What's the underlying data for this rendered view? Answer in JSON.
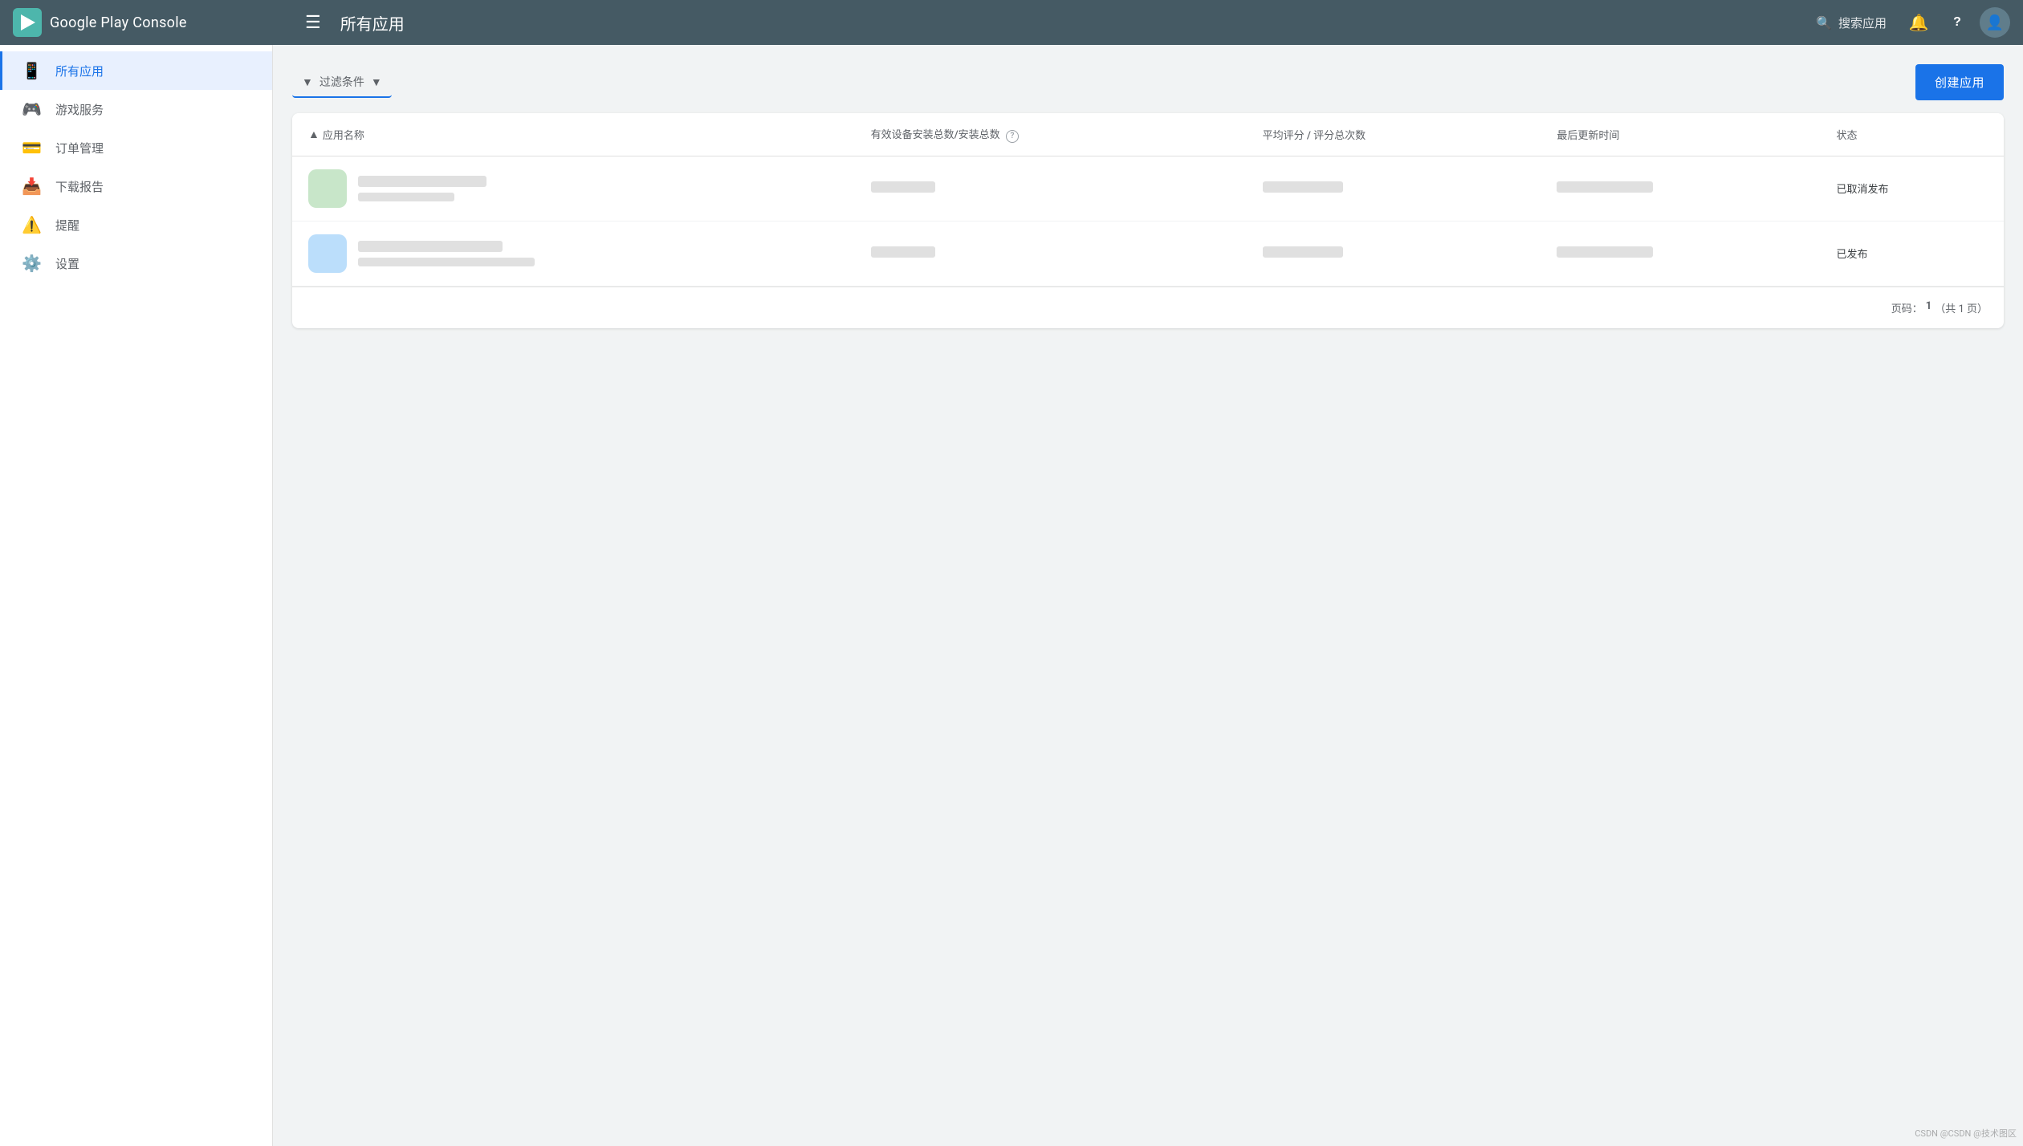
{
  "header": {
    "logo_text": "Google Play Console",
    "hamburger_label": "☰",
    "page_title": "所有应用",
    "search_placeholder": "搜索应用",
    "search_icon": "🔍",
    "notification_icon": "🔔",
    "help_icon": "?",
    "avatar_icon": "👤"
  },
  "sidebar": {
    "items": [
      {
        "id": "all-apps",
        "label": "所有应用",
        "icon": "📱",
        "active": true
      },
      {
        "id": "game-services",
        "label": "游戏服务",
        "icon": "🎮",
        "active": false
      },
      {
        "id": "order-mgmt",
        "label": "订单管理",
        "icon": "💳",
        "active": false
      },
      {
        "id": "reports",
        "label": "下载报告",
        "icon": "📥",
        "active": false
      },
      {
        "id": "alerts",
        "label": "提醒",
        "icon": "⚠️",
        "active": false
      },
      {
        "id": "settings",
        "label": "设置",
        "icon": "⚙️",
        "active": false
      }
    ]
  },
  "main": {
    "filter_label": "过滤条件",
    "filter_icon": "▼",
    "create_app_label": "创建应用",
    "table": {
      "columns": [
        {
          "id": "app-name",
          "label": "应用名称",
          "sortable": true,
          "sort_direction": "asc"
        },
        {
          "id": "installs",
          "label": "有效设备安装总数/安装总数",
          "has_info": true
        },
        {
          "id": "rating",
          "label": "平均评分 / 评分总次数"
        },
        {
          "id": "last-updated",
          "label": "最后更新时间"
        },
        {
          "id": "status",
          "label": "状态"
        }
      ],
      "rows": [
        {
          "id": "row-1",
          "app_name_redacted": true,
          "installs_redacted": true,
          "rating_redacted": true,
          "updated_redacted": true,
          "status": "已取消发布"
        },
        {
          "id": "row-2",
          "app_name_redacted": true,
          "installs_redacted": true,
          "rating_redacted": true,
          "updated_redacted": true,
          "status": "已发布"
        }
      ]
    },
    "pagination": {
      "label": "页码：",
      "current": "1",
      "total_label": "（共 1 页）"
    }
  },
  "watermark": "CSDN @CSDN @技术图区"
}
